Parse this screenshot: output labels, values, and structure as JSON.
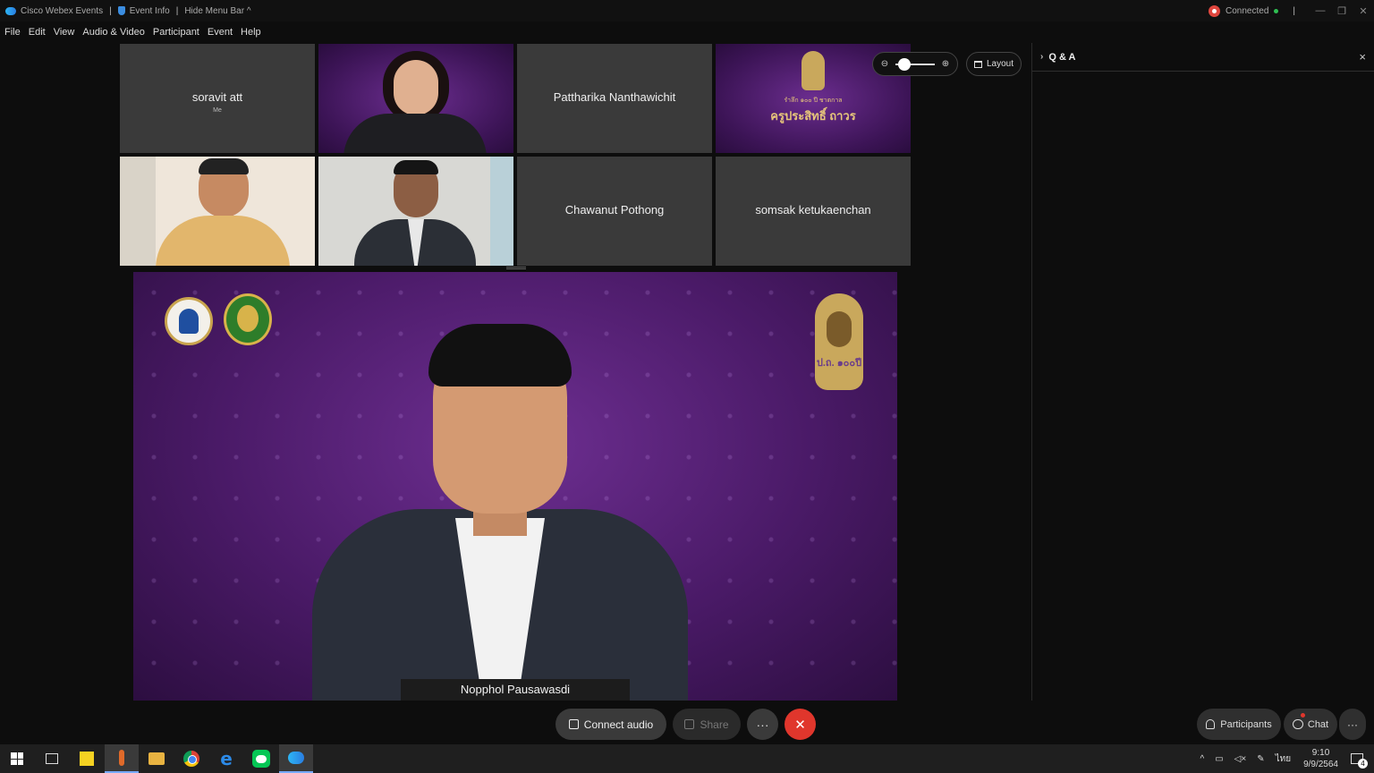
{
  "titlebar": {
    "app_name": "Cisco Webex Events",
    "sep1": "|",
    "event_info": "Event Info",
    "sep2": "|",
    "hide_menu": "Hide Menu Bar",
    "hide_menu_chevron": "^",
    "status": "Connected",
    "sep3": "|"
  },
  "menu": [
    "File",
    "Edit",
    "View",
    "Audio & Video",
    "Participant",
    "Event",
    "Help"
  ],
  "tiles": [
    {
      "name": "soravit att",
      "sub": "Me"
    },
    {
      "name": "",
      "sub": ""
    },
    {
      "name": "Pattharika Nanthawichit",
      "sub": ""
    },
    {
      "name": "",
      "sub": ""
    },
    {
      "name": "",
      "sub": ""
    },
    {
      "name": "",
      "sub": ""
    },
    {
      "name": "Chawanut Pothong",
      "sub": ""
    },
    {
      "name": "somsak ketukaenchan",
      "sub": ""
    }
  ],
  "banner": {
    "line1": "รำลึก ๑๐๐ ปี ชาตกาล",
    "line2": "ครูประสิทธิ์ ถาวร"
  },
  "emblem_text": "ป.ถ. ๑๐๐ปี",
  "main_speaker": "Nopphol Pausawasdi",
  "zoom": {
    "level": 0.1
  },
  "layout_label": "Layout",
  "panel": {
    "title": "Q & A",
    "close": "×"
  },
  "controls": {
    "connect_audio": "Connect audio",
    "share": "Share",
    "more": "···",
    "leave": "✕",
    "participants": "Participants",
    "chat": "Chat",
    "more2": "···"
  },
  "tray": {
    "lang": "ไทย",
    "time": "9:10",
    "date": "9/9/2564",
    "notifications": "4"
  }
}
